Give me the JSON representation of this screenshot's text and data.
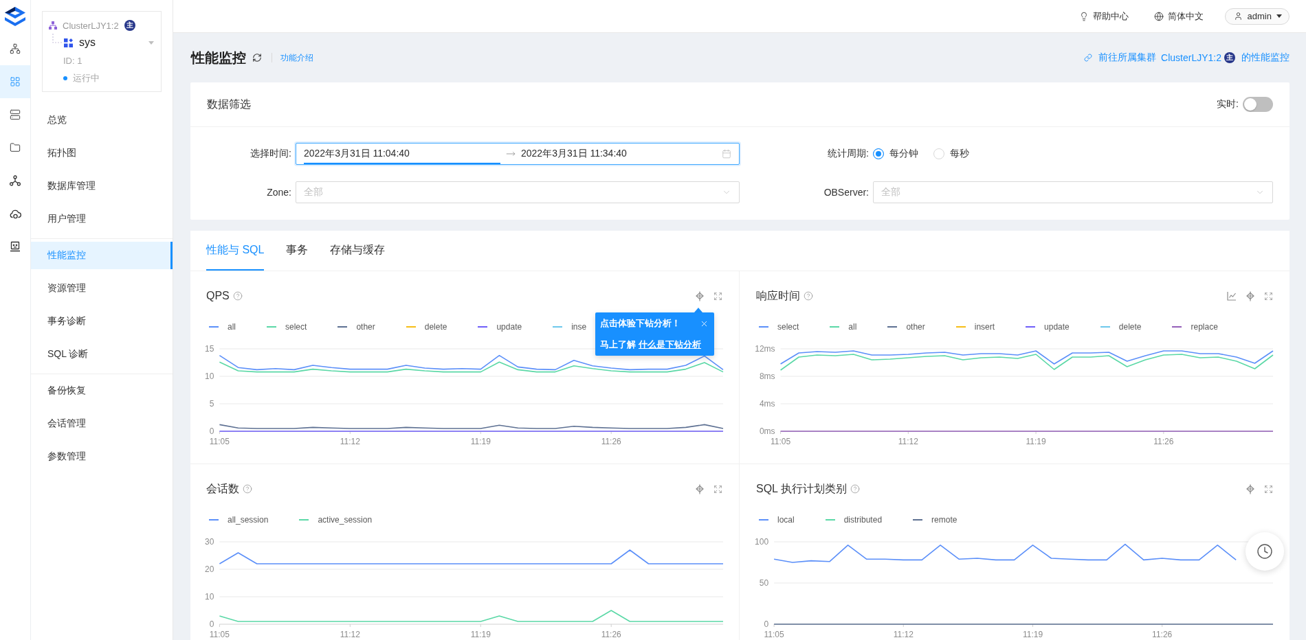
{
  "rail": {
    "items": [
      {
        "selected": false
      },
      {
        "selected": true
      },
      {
        "selected": false
      },
      {
        "selected": false
      },
      {
        "selected": false
      },
      {
        "selected": false
      },
      {
        "selected": false
      }
    ]
  },
  "instance": {
    "cluster": "ClusterLJY1:2",
    "badge": "主",
    "tenant": "sys",
    "id": "ID: 1",
    "status": "运行中"
  },
  "menu": {
    "groups": [
      {
        "items": [
          {
            "label": "总览",
            "selected": false
          },
          {
            "label": "拓扑图",
            "selected": false
          },
          {
            "label": "数据库管理",
            "selected": false
          },
          {
            "label": "用户管理",
            "selected": false
          }
        ]
      },
      {
        "items": [
          {
            "label": "性能监控",
            "selected": true
          },
          {
            "label": "资源管理",
            "selected": false
          },
          {
            "label": "事务诊断",
            "selected": false
          },
          {
            "label": "SQL 诊断",
            "selected": false
          }
        ]
      },
      {
        "items": [
          {
            "label": "备份恢复",
            "selected": false
          },
          {
            "label": "会话管理",
            "selected": false
          },
          {
            "label": "参数管理",
            "selected": false
          }
        ]
      }
    ]
  },
  "header": {
    "help": "帮助中心",
    "language": "简体中文",
    "user": "admin"
  },
  "page": {
    "title": "性能监控",
    "intro_link": "功能介绍",
    "cluster_link": {
      "prefix": "前往所属集群",
      "cluster": "ClusterLJY1:2",
      "badge": "主",
      "suffix": "的性能监控"
    }
  },
  "filter": {
    "title": "数据筛选",
    "realtime": {
      "label": "实时:",
      "on": false
    },
    "time": {
      "label": "选择时间:",
      "start": "2022年3月31日 11:04:40",
      "end": "2022年3月31日 11:34:40",
      "focused": true
    },
    "period": {
      "label": "统计周期:",
      "options": [
        {
          "label": "每分钟",
          "selected": true
        },
        {
          "label": "每秒",
          "selected": false
        }
      ]
    },
    "zone": {
      "label": "Zone:",
      "placeholder": "全部"
    },
    "observer": {
      "label": "OBServer:",
      "placeholder": "全部"
    }
  },
  "tabs": [
    {
      "label": "性能与 SQL",
      "selected": true
    },
    {
      "label": "事务",
      "selected": false
    },
    {
      "label": "存储与缓存",
      "selected": false
    }
  ],
  "charts": [
    {
      "title": "QPS",
      "sql_button": false,
      "popover": {
        "title": "点击体验下钻分析！",
        "text": "马上了解",
        "link": "什么是下钻分析"
      },
      "chart_data": {
        "type": "line",
        "categories": [
          "11:05",
          null,
          null,
          null,
          null,
          null,
          null,
          "11:12",
          null,
          null,
          null,
          null,
          null,
          null,
          "11:19",
          null,
          null,
          null,
          null,
          null,
          null,
          "11:26",
          null,
          null,
          null,
          null,
          null,
          null
        ],
        "ylim": [
          0,
          15
        ],
        "yticks": [
          0,
          5,
          10,
          15
        ],
        "series": [
          {
            "name": "all",
            "color": "#5b8ff9",
            "values": [
              13.8,
              11.6,
              11.2,
              11.4,
              11.2,
              12,
              11.6,
              11.3,
              11.3,
              11.3,
              12,
              11.5,
              11.3,
              11.4,
              11.3,
              13.8,
              11.7,
              11.3,
              11.2,
              12.9,
              11.9,
              11.5,
              11.2,
              11.3,
              11.3,
              12,
              13.7,
              11.2
            ]
          },
          {
            "name": "select",
            "color": "#5ad8a6",
            "values": [
              12.6,
              11,
              10.8,
              10.8,
              10.8,
              11.3,
              11,
              10.8,
              10.8,
              10.8,
              11.3,
              11,
              10.8,
              10.8,
              10.8,
              12.6,
              11.2,
              10.8,
              10.8,
              11.9,
              11.4,
              11,
              10.8,
              10.8,
              10.8,
              11.3,
              12.5,
              10.8
            ]
          },
          {
            "name": "other",
            "color": "#5d7092",
            "values": [
              1.2,
              0.6,
              0.5,
              0.5,
              0.5,
              0.7,
              0.6,
              0.5,
              0.5,
              0.5,
              0.7,
              0.6,
              0.5,
              0.5,
              0.5,
              1.1,
              0.6,
              0.5,
              0.5,
              0.9,
              0.7,
              0.6,
              0.5,
              0.5,
              0.5,
              0.7,
              1.2,
              0.5
            ]
          },
          {
            "name": "delete",
            "color": "#f6bd16",
            "values": [
              null,
              null,
              null,
              null,
              null,
              null,
              null,
              null,
              null,
              null,
              null,
              null,
              null,
              null,
              null,
              null,
              null,
              null,
              null,
              null,
              null,
              null,
              null,
              null,
              null,
              null,
              null,
              null
            ]
          },
          {
            "name": "update",
            "color": "#6f5ef9",
            "values": [
              0,
              0,
              0,
              0,
              0,
              0,
              0,
              0,
              0,
              0,
              0,
              0,
              0,
              0,
              0,
              0,
              0,
              0,
              0,
              0,
              0,
              0,
              0,
              0,
              0,
              0,
              0,
              0
            ]
          },
          {
            "name": "inse",
            "color": "#6dc8ec",
            "values": [
              null,
              null,
              null,
              null,
              null,
              null,
              null,
              null,
              null,
              null,
              null,
              null,
              null,
              null,
              null,
              null,
              null,
              null,
              null,
              null,
              null,
              null,
              null,
              null,
              null,
              null,
              null,
              null
            ]
          }
        ]
      }
    },
    {
      "title": "响应时间",
      "sql_button": true,
      "chart_data": {
        "type": "line",
        "categories": [
          "11:05",
          null,
          null,
          null,
          null,
          null,
          null,
          "11:12",
          null,
          null,
          null,
          null,
          null,
          null,
          "11:19",
          null,
          null,
          null,
          null,
          null,
          null,
          "11:26",
          null,
          null,
          null,
          null,
          null,
          null
        ],
        "ylim": [
          0,
          12
        ],
        "yticks": [
          {
            "value": 0,
            "label": "0ms"
          },
          {
            "value": 4,
            "label": "4ms"
          },
          {
            "value": 8,
            "label": "8ms"
          },
          {
            "value": 12,
            "label": "12ms"
          }
        ],
        "series": [
          {
            "name": "select",
            "color": "#5b8ff9",
            "values": [
              9.8,
              11.4,
              11.6,
              11.5,
              11.7,
              11.1,
              11.1,
              11.2,
              11.4,
              11.5,
              11.1,
              11.3,
              11.3,
              11.1,
              11.7,
              9.8,
              11.4,
              11.4,
              11.5,
              10.2,
              11,
              11.7,
              11.7,
              11.3,
              11.3,
              10.8,
              9.9,
              11.7
            ]
          },
          {
            "name": "all",
            "color": "#5ad8a6",
            "values": [
              8.9,
              10.8,
              11.1,
              11,
              11.2,
              10.4,
              10.5,
              10.7,
              10.9,
              11,
              10.4,
              10.7,
              10.8,
              10.6,
              11.2,
              9,
              10.8,
              10.8,
              11,
              9.4,
              10.4,
              11.1,
              11.2,
              10.7,
              10.8,
              10.2,
              9.1,
              11.1
            ]
          },
          {
            "name": "other",
            "color": "#5d7092",
            "values": [
              null,
              null,
              null,
              null,
              null,
              null,
              null,
              null,
              null,
              null,
              null,
              null,
              null,
              null,
              null,
              null,
              null,
              null,
              null,
              null,
              null,
              null,
              null,
              null,
              null,
              null,
              null,
              null
            ]
          },
          {
            "name": "insert",
            "color": "#f6bd16",
            "values": [
              null,
              null,
              null,
              null,
              null,
              null,
              null,
              null,
              null,
              null,
              null,
              null,
              null,
              null,
              null,
              null,
              null,
              null,
              null,
              null,
              null,
              null,
              null,
              null,
              null,
              null,
              null,
              null
            ]
          },
          {
            "name": "update",
            "color": "#6f5ef9",
            "values": [
              null,
              null,
              null,
              null,
              null,
              null,
              null,
              null,
              null,
              null,
              null,
              null,
              null,
              null,
              null,
              null,
              null,
              null,
              null,
              null,
              null,
              null,
              null,
              null,
              null,
              null,
              null,
              null
            ]
          },
          {
            "name": "delete",
            "color": "#6dc8ec",
            "values": [
              null,
              null,
              null,
              null,
              null,
              null,
              null,
              null,
              null,
              null,
              null,
              null,
              null,
              null,
              null,
              null,
              null,
              null,
              null,
              null,
              null,
              null,
              null,
              null,
              null,
              null,
              null,
              null
            ]
          },
          {
            "name": "replace",
            "color": "#945fb9",
            "values": [
              0,
              0,
              0,
              0,
              0,
              0,
              0,
              0,
              0,
              0,
              0,
              0,
              0,
              0,
              0,
              0,
              0,
              0,
              0,
              0,
              0,
              0,
              0,
              0,
              0,
              0,
              0,
              0
            ]
          }
        ]
      }
    },
    {
      "title": "会话数",
      "sql_button": false,
      "chart_data": {
        "type": "line",
        "categories": [
          "11:05",
          null,
          null,
          null,
          null,
          null,
          null,
          "11:12",
          null,
          null,
          null,
          null,
          null,
          null,
          "11:19",
          null,
          null,
          null,
          null,
          null,
          null,
          "11:26",
          null,
          null,
          null,
          null,
          null,
          null
        ],
        "ylim": [
          0,
          30
        ],
        "yticks": [
          0,
          10,
          20,
          30
        ],
        "series": [
          {
            "name": "all_session",
            "color": "#5b8ff9",
            "values": [
              22,
              26,
              22,
              22,
              22,
              22,
              22,
              22,
              22,
              22,
              22,
              22,
              22,
              22,
              22,
              22,
              22,
              22,
              22,
              22,
              22,
              22,
              27,
              22,
              22,
              22,
              22,
              22
            ]
          },
          {
            "name": "active_session",
            "color": "#5ad8a6",
            "values": [
              3,
              1,
              1,
              1,
              1,
              1,
              1,
              1,
              1,
              1,
              1,
              1,
              1,
              1,
              1,
              3,
              1,
              1,
              1,
              1,
              1,
              5,
              1,
              1,
              1,
              1,
              1,
              1
            ]
          }
        ]
      }
    },
    {
      "title": "SQL 执行计划类别",
      "sql_button": false,
      "chart_data": {
        "type": "line",
        "categories": [
          "11:05",
          null,
          null,
          null,
          null,
          null,
          null,
          "11:12",
          null,
          null,
          null,
          null,
          null,
          null,
          "11:19",
          null,
          null,
          null,
          null,
          null,
          null,
          "11:26",
          null,
          null,
          null,
          null,
          null,
          null
        ],
        "ylim": [
          0,
          100
        ],
        "yticks": [
          0,
          50,
          100
        ],
        "series": [
          {
            "name": "local",
            "color": "#5b8ff9",
            "values": [
              79,
              75,
              77,
              76,
              96,
              79,
              79,
              78,
              78,
              96,
              79,
              80,
              78,
              78,
              96,
              80,
              79,
              78,
              78,
              97,
              78,
              80,
              78,
              78,
              96,
              78,
              null,
              null
            ]
          },
          {
            "name": "distributed",
            "color": "#5ad8a6",
            "values": [
              null,
              null,
              null,
              null,
              null,
              null,
              null,
              null,
              null,
              null,
              null,
              null,
              null,
              null,
              null,
              null,
              null,
              null,
              null,
              null,
              null,
              null,
              null,
              null,
              null,
              null,
              null,
              null
            ]
          },
          {
            "name": "remote",
            "color": "#5d7092",
            "values": [
              0,
              0,
              0,
              0,
              0,
              0,
              0,
              0,
              0,
              0,
              0,
              0,
              0,
              0,
              0,
              0,
              0,
              0,
              0,
              0,
              0,
              0,
              0,
              0,
              0,
              0,
              0,
              0
            ]
          }
        ]
      }
    }
  ]
}
